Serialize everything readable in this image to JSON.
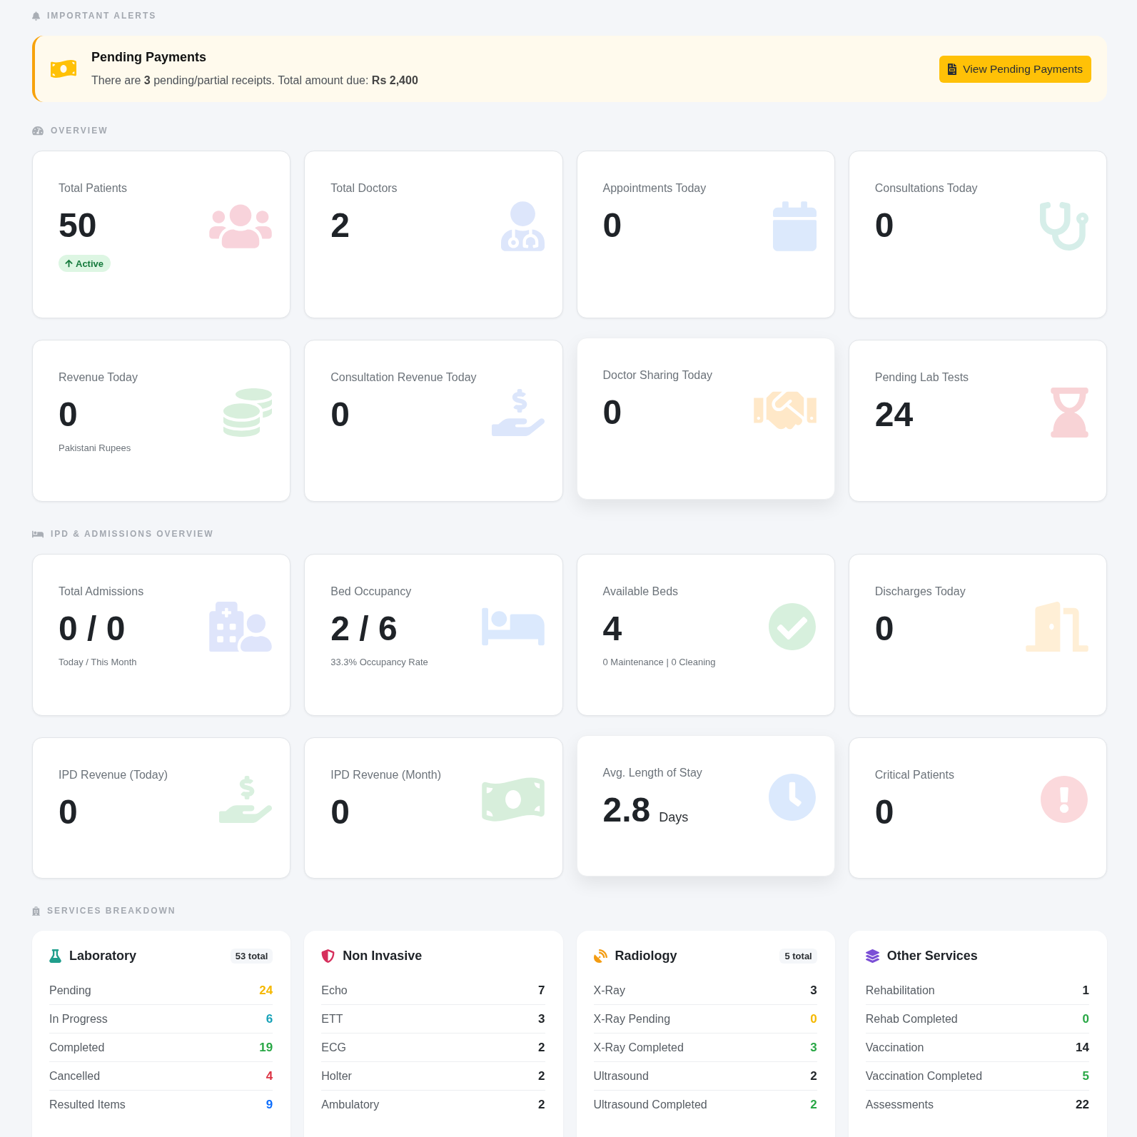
{
  "alerts": {
    "heading": "IMPORTANT ALERTS",
    "alert": {
      "title": "Pending Payments",
      "message": "There are **3** pending/partial receipts. Total amount due: **Rs 2,400**",
      "action": "View Pending Payments"
    }
  },
  "overview": {
    "heading": "OVERVIEW",
    "cards": [
      {
        "label": "Total Patients",
        "value": "50",
        "badge": "Active",
        "raised": false
      },
      {
        "label": "Total Doctors",
        "value": "2",
        "raised": false
      },
      {
        "label": "Appointments Today",
        "value": "0",
        "raised": false
      },
      {
        "label": "Consultations Today",
        "value": "0",
        "raised": false
      },
      {
        "label": "Revenue Today",
        "value": "0",
        "note": "Pakistani Rupees",
        "raised": false
      },
      {
        "label": "Consultation Revenue Today",
        "value": "0",
        "raised": false
      },
      {
        "label": "Doctor Sharing Today",
        "value": "0",
        "raised": true
      },
      {
        "label": "Pending Lab Tests",
        "value": "24",
        "raised": false
      }
    ]
  },
  "ipd": {
    "heading": "IPD & ADMISSIONS OVERVIEW",
    "cards": [
      {
        "label": "Total Admissions",
        "value": "0 / 0",
        "note": "Today / This Month",
        "raised": false
      },
      {
        "label": "Bed Occupancy",
        "value": "2 / 6",
        "note": "33.3% Occupancy Rate",
        "raised": false
      },
      {
        "label": "Available Beds",
        "value": "4",
        "note": "0 Maintenance | 0 Cleaning",
        "raised": false
      },
      {
        "label": "Discharges Today",
        "value": "0",
        "raised": false
      },
      {
        "label": "IPD Revenue (Today)",
        "value": "0",
        "raised": false
      },
      {
        "label": "IPD Revenue (Month)",
        "value": "0",
        "raised": false
      },
      {
        "label": "Avg. Length of Stay",
        "value": "2.8",
        "unit": "Days",
        "raised": true
      },
      {
        "label": "Critical Patients",
        "value": "0",
        "raised": false
      }
    ]
  },
  "services": {
    "heading": "SERVICES BREAKDOWN",
    "cards": [
      {
        "title": "Laboratory",
        "total": "53 total",
        "rows": [
          {
            "label": "Pending",
            "value": "24",
            "color": "#f5b800"
          },
          {
            "label": "In Progress",
            "value": "6",
            "color": "#17a2b8"
          },
          {
            "label": "Completed",
            "value": "19",
            "color": "#28a745"
          },
          {
            "label": "Cancelled",
            "value": "4",
            "color": "#dc3545"
          },
          {
            "label": "Resulted Items",
            "value": "9",
            "color": "#0d6efd"
          }
        ]
      },
      {
        "title": "Non Invasive",
        "rows": [
          {
            "label": "Echo",
            "value": "7",
            "color": "#212529"
          },
          {
            "label": "ETT",
            "value": "3",
            "color": "#212529"
          },
          {
            "label": "ECG",
            "value": "2",
            "color": "#212529"
          },
          {
            "label": "Holter",
            "value": "2",
            "color": "#212529"
          },
          {
            "label": "Ambulatory",
            "value": "2",
            "color": "#212529"
          }
        ]
      },
      {
        "title": "Radiology",
        "total": "5 total",
        "rows": [
          {
            "label": "X-Ray",
            "value": "3",
            "color": "#212529"
          },
          {
            "label": "X-Ray Pending",
            "value": "0",
            "color": "#f5b800"
          },
          {
            "label": "X-Ray Completed",
            "value": "3",
            "color": "#28a745"
          },
          {
            "label": "Ultrasound",
            "value": "2",
            "color": "#212529"
          },
          {
            "label": "Ultrasound Completed",
            "value": "2",
            "color": "#28a745"
          }
        ]
      },
      {
        "title": "Other Services",
        "rows": [
          {
            "label": "Rehabilitation",
            "value": "1",
            "color": "#212529"
          },
          {
            "label": "Rehab Completed",
            "value": "0",
            "color": "#28a745"
          },
          {
            "label": "Vaccination",
            "value": "14",
            "color": "#212529"
          },
          {
            "label": "Vaccination Completed",
            "value": "5",
            "color": "#28a745"
          },
          {
            "label": "Assessments",
            "value": "22",
            "color": "#212529"
          }
        ]
      }
    ]
  }
}
